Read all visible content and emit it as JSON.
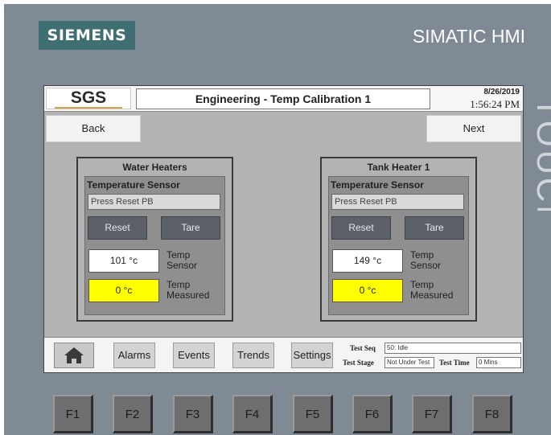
{
  "device": {
    "brand": "SIEMENS",
    "product": "SIMATIC HMI",
    "bezel_mark": "TOUCH"
  },
  "header": {
    "logo": "SGS",
    "title": "Engineering - Temp Calibration 1",
    "date": "8/26/2019",
    "time": "1:56:24 PM"
  },
  "nav": {
    "back": "Back",
    "next": "Next"
  },
  "panels": [
    {
      "title": "Water Heaters",
      "sensor_label": "Temperature Sensor",
      "message": "Press Reset PB",
      "reset": "Reset",
      "tare": "Tare",
      "sensor_value": "101 °c",
      "sensor_caption_1": "Temp",
      "sensor_caption_2": "Sensor",
      "measured_value": "0 °c",
      "measured_caption_1": "Temp",
      "measured_caption_2": "Measured"
    },
    {
      "title": "Tank Heater 1",
      "sensor_label": "Temperature Sensor",
      "message": "Press Reset PB",
      "reset": "Reset",
      "tare": "Tare",
      "sensor_value": "149 °c",
      "sensor_caption_1": "Temp",
      "sensor_caption_2": "Sensor",
      "measured_value": "0 °c",
      "measured_caption_1": "Temp",
      "measured_caption_2": "Measured"
    }
  ],
  "bottom_bar": {
    "home_icon": "house-icon",
    "buttons": [
      "Alarms",
      "Events",
      "Trends",
      "Settings"
    ],
    "test_seq_label": "Test Seq",
    "test_seq_value": "50: Idle",
    "test_stage_label": "Test Stage",
    "test_stage_value": "Not Under Test",
    "test_time_label": "Test Time",
    "test_time_value": "0 Mins"
  },
  "function_keys": [
    "F1",
    "F2",
    "F3",
    "F4",
    "F5",
    "F6",
    "F7",
    "F8"
  ],
  "colors": {
    "bezel": "#7f8a95",
    "brand": "#3f6f73",
    "screen": "#b3b3b3",
    "button_dark": "#5b6069",
    "measured_highlight": "#ffff00"
  }
}
